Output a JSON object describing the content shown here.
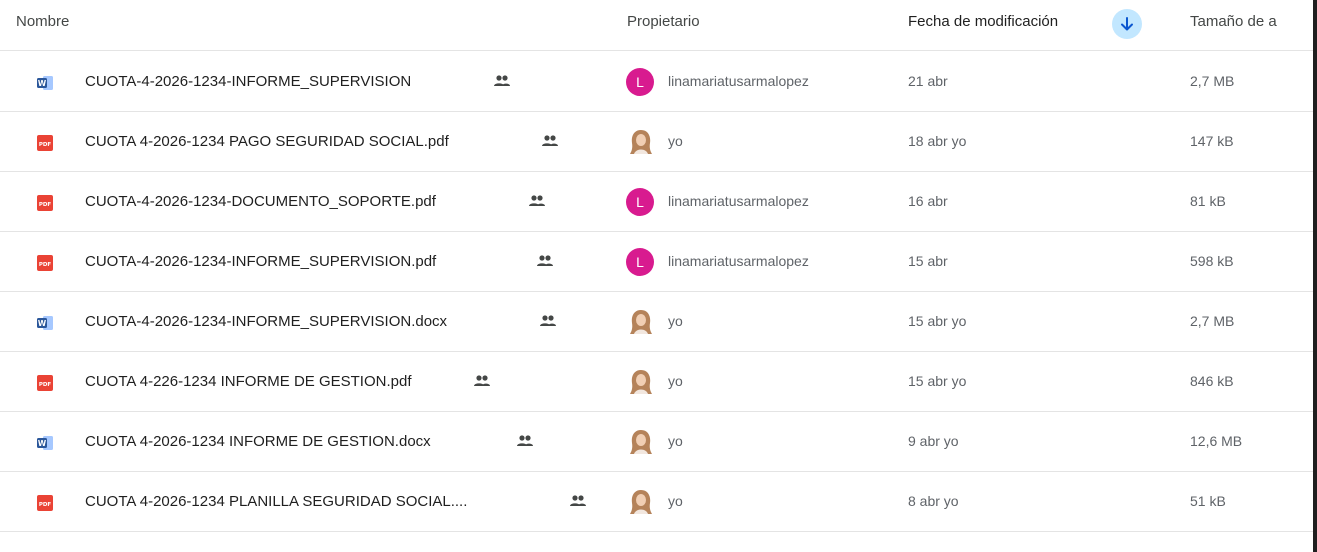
{
  "header": {
    "name": "Nombre",
    "owner": "Propietario",
    "modified": "Fecha de modificación",
    "size": "Tamaño de a"
  },
  "icons": {
    "sort": "arrow-down-icon",
    "shared": "people-icon",
    "docx": "word-doc-icon",
    "pdf": "pdf-icon"
  },
  "colors": {
    "avatar_l": "#d81b8f",
    "pdf_red": "#ea4335",
    "word_blue": "#2b579a",
    "sort_bg": "#c2e7ff",
    "sort_arrow": "#0b57d0"
  },
  "files": [
    {
      "type": "docx",
      "name": "CUOTA-4-2026-1234-INFORME_SUPERVISION",
      "owner": "linamariatusarmalopez",
      "owner_avatar": "L",
      "modified": "21 abr",
      "size": "2,7 MB"
    },
    {
      "type": "pdf",
      "name": "CUOTA 4-2026-1234 PAGO SEGURIDAD SOCIAL.pdf",
      "owner": "yo",
      "owner_avatar": "photo",
      "modified": "18 abr yo",
      "size": "147 kB"
    },
    {
      "type": "pdf",
      "name": "CUOTA-4-2026-1234-DOCUMENTO_SOPORTE.pdf",
      "owner": "linamariatusarmalopez",
      "owner_avatar": "L",
      "modified": "16 abr",
      "size": "81 kB"
    },
    {
      "type": "pdf",
      "name": "CUOTA-4-2026-1234-INFORME_SUPERVISION.pdf",
      "owner": "linamariatusarmalopez",
      "owner_avatar": "L",
      "modified": "15 abr",
      "size": "598 kB"
    },
    {
      "type": "docx",
      "name": "CUOTA-4-2026-1234-INFORME_SUPERVISION.docx",
      "owner": "yo",
      "owner_avatar": "photo",
      "modified": "15 abr yo",
      "size": "2,7 MB"
    },
    {
      "type": "pdf",
      "name": "CUOTA 4-226-1234 INFORME DE GESTION.pdf",
      "owner": "yo",
      "owner_avatar": "photo",
      "modified": "15 abr yo",
      "size": "846 kB"
    },
    {
      "type": "docx",
      "name": "CUOTA 4-2026-1234 INFORME DE GESTION.docx",
      "owner": "yo",
      "owner_avatar": "photo",
      "modified": "9 abr yo",
      "size": "12,6 MB"
    },
    {
      "type": "pdf",
      "name": "CUOTA 4-2026-1234 PLANILLA SEGURIDAD SOCIAL....",
      "owner": "yo",
      "owner_avatar": "photo",
      "modified": "8 abr yo",
      "size": "51 kB"
    }
  ]
}
